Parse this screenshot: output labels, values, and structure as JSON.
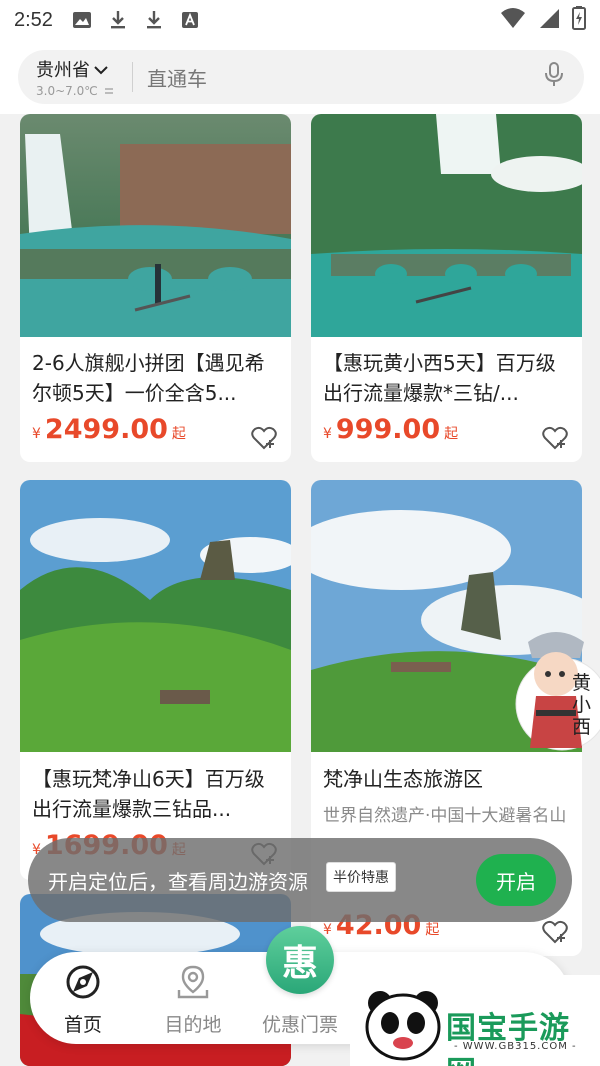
{
  "status_bar": {
    "time": "2:52"
  },
  "header": {
    "location": "贵州省",
    "temperature": "3.0~7.0℃",
    "search_placeholder": "直通车"
  },
  "cards": [
    {
      "title": "2-6人旗舰小拼团【遇见希尔顿5天】一价全含5...",
      "currency": "¥",
      "price": "2499.00",
      "suffix": "起"
    },
    {
      "title": "【惠玩黄小西5天】百万级出行流量爆款*三钻/...",
      "currency": "¥",
      "price": "999.00",
      "suffix": "起"
    },
    {
      "title": "【惠玩梵净山6天】百万级出行流量爆款三钻品...",
      "currency": "¥",
      "price": "1699.00",
      "suffix": "起"
    },
    {
      "title": "梵净山生态旅游区",
      "subtitle": "世界自然遗产·中国十大避暑名山",
      "tag": "半价特惠",
      "currency": "¥",
      "price": "42.00",
      "suffix": "起"
    }
  ],
  "toast": {
    "text": "开启定位后，查看周边游资源",
    "button": "开启"
  },
  "bottom_nav": {
    "items": [
      {
        "label": "首页",
        "icon": "compass-icon"
      },
      {
        "label": "目的地",
        "icon": "map-pin-icon"
      },
      {
        "label": "优惠门票",
        "icon": "hui-badge-icon"
      }
    ],
    "hui_char": "惠"
  },
  "mascot": {
    "text": "黄小西"
  },
  "watermark": {
    "logo": "国宝手游网",
    "url": "- WWW.GB315.COM -"
  },
  "colors": {
    "accent": "#e8492a",
    "green": "#1fb14f",
    "brand_green": "#2aa778"
  }
}
